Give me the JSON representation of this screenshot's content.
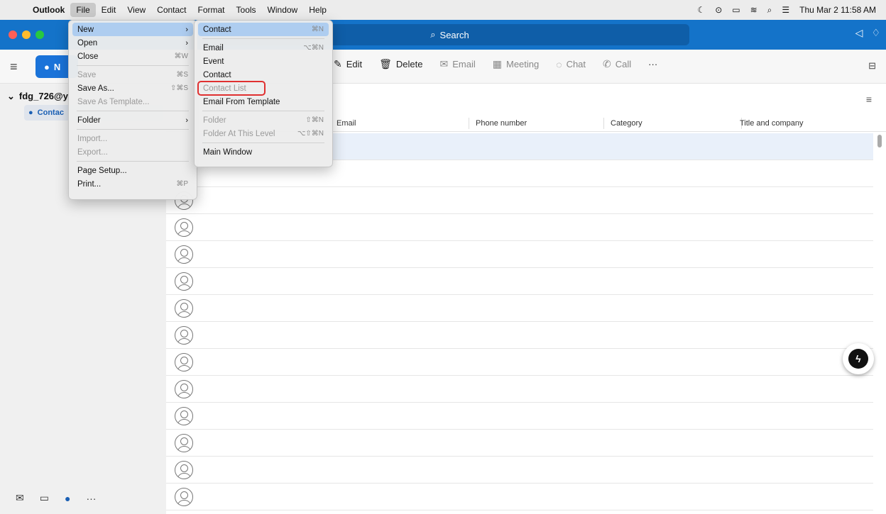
{
  "menubar": {
    "app": "Outlook",
    "menus": [
      "File",
      "Edit",
      "View",
      "Contact",
      "Format",
      "Tools",
      "Window",
      "Help"
    ],
    "datetime": "Thu Mar 2  11:58 AM"
  },
  "titlebar": {
    "search_label": "Search"
  },
  "toolbar": {
    "new_label": "N",
    "actions": [
      {
        "label": "Edit",
        "icon": "pencil-icon"
      },
      {
        "label": "Delete",
        "icon": "trash-icon"
      },
      {
        "label": "Email",
        "icon": "mail-icon"
      },
      {
        "label": "Meeting",
        "icon": "calendar-icon"
      },
      {
        "label": "Chat",
        "icon": "chat-icon"
      },
      {
        "label": "Call",
        "icon": "phone-icon"
      },
      {
        "label": "···",
        "icon": "more-icon"
      }
    ]
  },
  "sidebar": {
    "account": "fdg_726@y",
    "folder": "Contac"
  },
  "columns": [
    "Email",
    "Phone number",
    "Category",
    "Title and company"
  ],
  "file_menu": {
    "items": [
      {
        "label": "New",
        "shortcut": "",
        "submenu": true,
        "disabled": false,
        "highlight": true
      },
      {
        "label": "Open",
        "shortcut": "",
        "submenu": true,
        "disabled": false
      },
      {
        "label": "Close",
        "shortcut": "⌘W",
        "submenu": false,
        "disabled": false
      },
      {
        "label": "Save",
        "shortcut": "⌘S",
        "disabled": true
      },
      {
        "label": "Save As...",
        "shortcut": "⇧⌘S",
        "disabled": false
      },
      {
        "label": "Save As Template...",
        "shortcut": "",
        "disabled": true
      },
      {
        "label": "Folder",
        "shortcut": "",
        "submenu": true,
        "disabled": false
      },
      {
        "label": "Import...",
        "shortcut": "",
        "disabled": true
      },
      {
        "label": "Export...",
        "shortcut": "",
        "disabled": true
      },
      {
        "label": "Page Setup...",
        "shortcut": "",
        "disabled": false
      },
      {
        "label": "Print...",
        "shortcut": "⌘P",
        "disabled": false
      }
    ]
  },
  "new_submenu": {
    "items": [
      {
        "label": "Contact",
        "shortcut": "⌘N",
        "disabled": false,
        "highlight": true
      },
      {
        "label": "Email",
        "shortcut": "⌥⌘N",
        "disabled": false
      },
      {
        "label": "Event",
        "shortcut": "",
        "disabled": false
      },
      {
        "label": "Contact",
        "shortcut": "",
        "disabled": false
      },
      {
        "label": "Contact List",
        "shortcut": "",
        "disabled": true
      },
      {
        "label": "Email From Template",
        "shortcut": "",
        "disabled": false
      },
      {
        "label": "Folder",
        "shortcut": "⇧⌘N",
        "disabled": true
      },
      {
        "label": "Folder At This Level",
        "shortcut": "⌥⇧⌘N",
        "disabled": true
      },
      {
        "label": "Main Window",
        "shortcut": "",
        "disabled": false
      }
    ]
  },
  "colors": {
    "accent": "#1473c9",
    "highlight_box": "#e03030"
  }
}
